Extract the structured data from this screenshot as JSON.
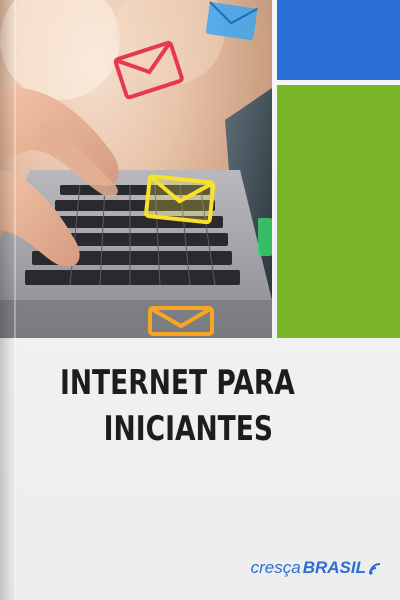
{
  "cover": {
    "title_line1": "INTERNET PARA",
    "title_line2": "INICIANTES",
    "brand_part1": "cresça",
    "brand_part2": "BRASIL"
  },
  "colors": {
    "blue_block": "#2a6fd6",
    "green_block": "#7ab528",
    "title_text": "#1d1d1d",
    "brand": "#2a6fd6"
  },
  "icons": {
    "photo_envelopes": [
      "envelope-icon-blue",
      "envelope-icon-red",
      "envelope-icon-yellow",
      "envelope-icon-orange",
      "envelope-icon-green"
    ],
    "brand_mark": "signal-icon"
  }
}
